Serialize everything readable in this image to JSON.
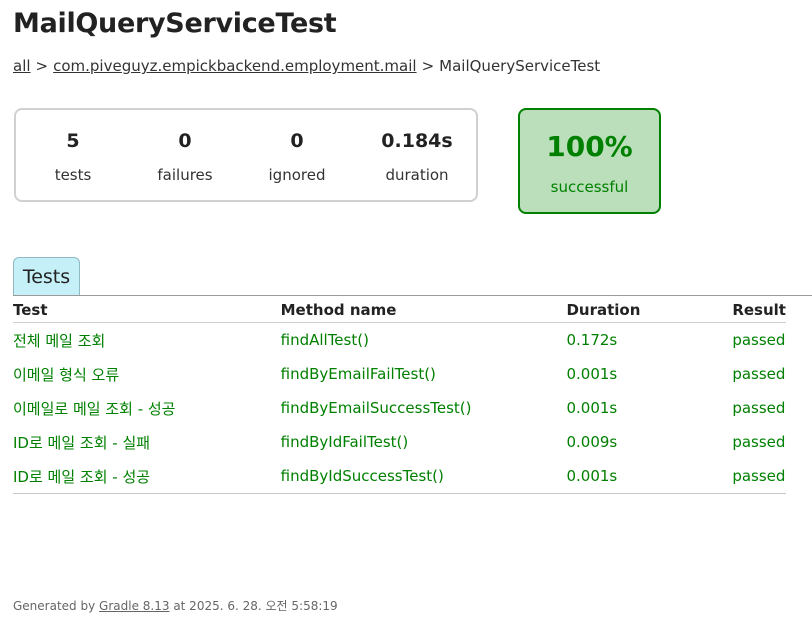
{
  "page": {
    "title": "MailQueryServiceTest"
  },
  "breadcrumb": {
    "root": "all",
    "sep1": ">",
    "package": "com.piveguyz.empickbackend.employment.mail",
    "sep2": ">",
    "current": "MailQueryServiceTest"
  },
  "summary": {
    "tests": {
      "value": "5",
      "label": "tests"
    },
    "failures": {
      "value": "0",
      "label": "failures"
    },
    "ignored": {
      "value": "0",
      "label": "ignored"
    },
    "duration": {
      "value": "0.184s",
      "label": "duration"
    },
    "success_rate": {
      "value": "100%",
      "label": "successful"
    }
  },
  "tabs": [
    {
      "label": "Tests"
    }
  ],
  "table": {
    "headers": [
      "Test",
      "Method name",
      "Duration",
      "Result"
    ],
    "rows": [
      {
        "test": "전체 메일 조회",
        "method": "findAllTest()",
        "duration": "0.172s",
        "result": "passed"
      },
      {
        "test": "이메일 형식 오류",
        "method": "findByEmailFailTest()",
        "duration": "0.001s",
        "result": "passed"
      },
      {
        "test": "이메일로 메일 조회 - 성공",
        "method": "findByEmailSuccessTest()",
        "duration": "0.001s",
        "result": "passed"
      },
      {
        "test": "ID로 메일 조회 - 실패",
        "method": "findByIdFailTest()",
        "duration": "0.009s",
        "result": "passed"
      },
      {
        "test": "ID로 메일 조회 - 성공",
        "method": "findByIdSuccessTest()",
        "duration": "0.001s",
        "result": "passed"
      }
    ]
  },
  "footer": {
    "prefix": "Generated by",
    "tool": "Gradle 8.13",
    "suffix": "at 2025. 6. 28. 오전 5:58:19"
  },
  "colors": {
    "success": "#008000",
    "success_bg": "#bbdfba",
    "tab_bg": "#c5f0f8"
  }
}
